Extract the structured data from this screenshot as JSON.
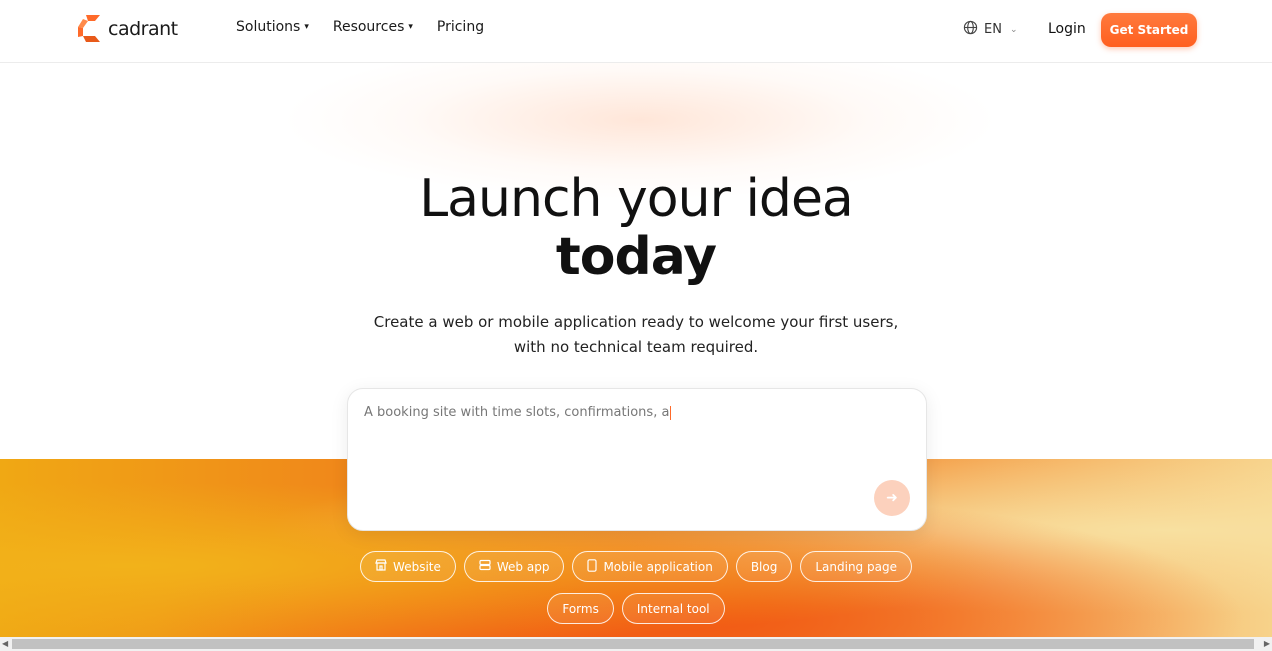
{
  "brand": {
    "name": "cadrant",
    "accent": "#ff6a2a"
  },
  "nav": {
    "items": [
      {
        "label": "Solutions",
        "has_dropdown": true
      },
      {
        "label": "Resources",
        "has_dropdown": true
      },
      {
        "label": "Pricing",
        "has_dropdown": false
      }
    ]
  },
  "header": {
    "language": "EN",
    "login_label": "Login",
    "cta_label": "Get Started"
  },
  "hero": {
    "title_line1": "Launch your idea",
    "title_line2": "today",
    "subtitle_line1": "Create a web or mobile application ready to welcome your first users,",
    "subtitle_line2": "with no technical team required."
  },
  "prompt": {
    "value": "A booking site with time slots, confirmations, a",
    "send_icon": "arrow-right-icon"
  },
  "chips": {
    "row1": [
      {
        "label": "Website",
        "icon": "store-icon"
      },
      {
        "label": "Web app",
        "icon": "layout-icon"
      },
      {
        "label": "Mobile application",
        "icon": "phone-icon"
      },
      {
        "label": "Blog",
        "icon": ""
      },
      {
        "label": "Landing page",
        "icon": ""
      }
    ],
    "row2": [
      {
        "label": "Forms",
        "icon": ""
      },
      {
        "label": "Internal tool",
        "icon": ""
      }
    ]
  }
}
